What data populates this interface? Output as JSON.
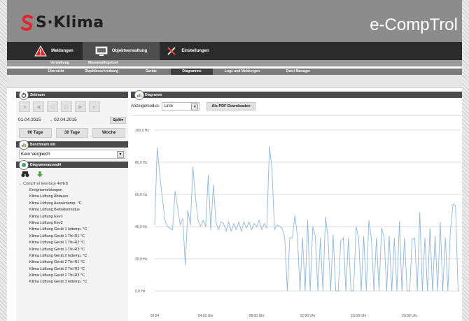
{
  "header": {
    "logo_text": "S·Klima",
    "brand": "e-CompTrol"
  },
  "main_tabs": [
    {
      "label": "Meldungen",
      "icon": "warning-icon"
    },
    {
      "label": "Objektverwaltung",
      "icon": "monitor-icon",
      "active": true
    },
    {
      "label": "Einstellungen",
      "icon": "tools-icon"
    }
  ],
  "sub_nav_1": [
    "Verwaltung",
    "Massenpflegetool"
  ],
  "sub_nav_2": [
    {
      "label": "Übersicht"
    },
    {
      "label": "Objektbeschreibung"
    },
    {
      "label": "Geräte"
    },
    {
      "label": "Diagramme",
      "active": true
    },
    {
      "label": "Logs und Meldungen"
    },
    {
      "label": "Datei Manager"
    }
  ],
  "sidebar": {
    "timerange": {
      "title": "Zeitraum",
      "date_from": "01.04.2015",
      "date_sep": "-",
      "date_to": "02.04.2015",
      "split_label": "Split",
      "presets": [
        "90 Tage",
        "30 Tage",
        "Woche"
      ]
    },
    "benchmark": {
      "title": "Benchmark mit",
      "value": "Kein Vergleich"
    },
    "diagram_select": {
      "title": "Diagrammauswahl",
      "root": "CompTrol Interface 4WEB",
      "items": [
        "Ereignismeldungen",
        "Klima Lüftung Abtauen",
        "Klima Lüftung Aussentemp. °C",
        "Klima Lüftung Betriebsmodus",
        "Klima Lüftung Eev1",
        "Klima Lüftung Eev2",
        "Klima Lüftung Gerät 1 Isttemp. °C",
        "Klima Lüftung Gerät 1 Thi-R1 °C",
        "Klima Lüftung Gerät 1 Thi-R2 °C",
        "Klima Lüftung Gerät 1 Thi-R3 °C",
        "Klima Lüftung Gerät 2 Isttemp. °C",
        "Klima Lüftung Gerät 2 Thi-R1 °C",
        "Klima Lüftung Gerät 2 Thi-R2 °C",
        "Klima Lüftung Gerät 2 Thi-R3 °C",
        "Klima Lüftung Gerät 3 Isttemp. °C"
      ]
    }
  },
  "chart_panel": {
    "title": "Diagramm",
    "mode_label": "Anzeigemodus:",
    "mode_value": "Linie",
    "pdf_label": "Als PDF Downloaden"
  },
  "chart_data": {
    "type": "line",
    "y_ticks": [
      "100,0 Hz",
      "80,0 Hz",
      "60,0 Hz",
      "40,0 Hz",
      "20,0 Hz",
      "0,0 Hz"
    ],
    "x_ticks": [
      "02.04",
      "04:00 Uhr",
      "08:00 Uhr",
      "12:00 Uhr",
      "16:00 Uhr",
      "20:00 Uhr"
    ],
    "y_unit": "Hz",
    "ylim": [
      0,
      100
    ],
    "grid": true,
    "line_color": "#8fb6dc",
    "series": [
      {
        "x": [
          0,
          0.2,
          0.4,
          0.6,
          0.8,
          1,
          1.2,
          1.4,
          1.6,
          1.8,
          2,
          2.2,
          2.4,
          2.6,
          2.8,
          3,
          3.2,
          3.4,
          3.6,
          3.8,
          4,
          4.2,
          4.4,
          4.6,
          4.8,
          5,
          5.2,
          5.4,
          5.6,
          5.8,
          6,
          6.2,
          6.4,
          6.6,
          6.8,
          7,
          7.2,
          7.4,
          7.6,
          7.8,
          8,
          8.2,
          8.4,
          8.6,
          8.8,
          9,
          9.2,
          9.4,
          9.6,
          9.8,
          10,
          10.2,
          10.4,
          10.6,
          10.8,
          11,
          11.2,
          11.4,
          11.6,
          11.8,
          12,
          12.2,
          12.4,
          12.6,
          12.8,
          13,
          13.2,
          13.4,
          13.6,
          13.8,
          14,
          14.2,
          14.4,
          14.6,
          14.8,
          15,
          15.2,
          15.4,
          15.6,
          15.8,
          16,
          16.2,
          16.4,
          16.6,
          16.8,
          17,
          17.2,
          17.4,
          17.6,
          17.8,
          18,
          18.2,
          18.4,
          18.6,
          18.8,
          19,
          19.2,
          19.4,
          19.6,
          19.8,
          20,
          20.2,
          20.4,
          20.6,
          20.8,
          21,
          21.2,
          21.4,
          21.6,
          21.8,
          22,
          22.2,
          22.4,
          22.6,
          22.8,
          23,
          23.2,
          23.4,
          23.6,
          23.8
        ],
        "y": [
          41,
          89,
          72,
          58,
          44,
          40,
          39,
          38,
          62,
          52,
          41,
          45,
          16,
          50,
          41,
          77,
          58,
          44,
          40,
          44,
          40,
          72,
          38,
          66,
          43,
          38,
          43,
          42,
          37,
          43,
          37,
          42,
          38,
          43,
          37,
          43,
          39,
          43,
          38,
          42,
          40,
          44,
          38,
          42,
          39,
          90,
          76,
          38,
          41,
          40,
          39,
          33,
          0,
          33,
          33,
          47,
          34,
          0,
          33,
          0,
          44,
          0,
          40,
          34,
          0,
          33,
          0,
          46,
          33,
          0,
          35,
          0,
          0,
          31,
          33,
          0,
          33,
          0,
          0,
          40,
          33,
          0,
          34,
          0,
          44,
          33,
          0,
          33,
          0,
          39,
          33,
          0,
          34,
          0,
          33,
          0,
          43,
          0,
          33,
          0,
          0,
          32,
          33,
          0,
          49,
          0,
          33,
          0,
          39,
          0,
          34,
          0,
          43,
          0,
          33,
          0,
          37,
          54,
          53,
          0
        ]
      }
    ]
  }
}
